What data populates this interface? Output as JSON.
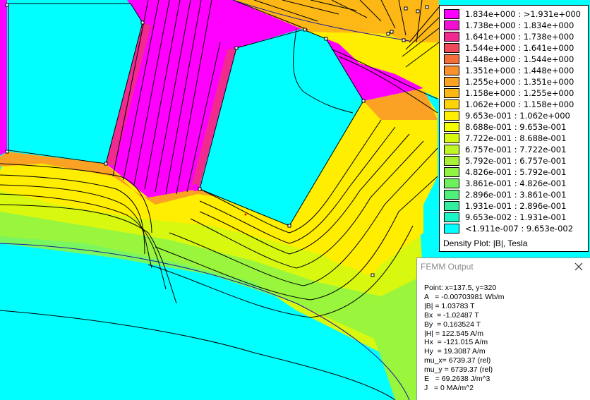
{
  "legend": {
    "entries": [
      {
        "label": "1.834e+000 : >1.931e+000",
        "color": "#ff00ff"
      },
      {
        "label": "1.738e+000 : 1.834e+000",
        "color": "#f10fd2"
      },
      {
        "label": "1.641e+000 : 1.738e+000",
        "color": "#f02a8f"
      },
      {
        "label": "1.544e+000 : 1.641e+000",
        "color": "#ee4a5a"
      },
      {
        "label": "1.448e+000 : 1.544e+000",
        "color": "#f46e3a"
      },
      {
        "label": "1.351e+000 : 1.448e+000",
        "color": "#f8902c"
      },
      {
        "label": "1.255e+000 : 1.351e+000",
        "color": "#fba124"
      },
      {
        "label": "1.158e+000 : 1.255e+000",
        "color": "#fdb815"
      },
      {
        "label": "1.062e+000 : 1.158e+000",
        "color": "#ffd30a"
      },
      {
        "label": "9.653e-001 : 1.062e+000",
        "color": "#ffee00"
      },
      {
        "label": "8.688e-001 : 9.653e-001",
        "color": "#f3ff00"
      },
      {
        "label": "7.722e-001 : 8.688e-001",
        "color": "#d8f810"
      },
      {
        "label": "6.757e-001 : 7.722e-001",
        "color": "#bef524"
      },
      {
        "label": "5.792e-001 : 6.757e-001",
        "color": "#a8f035"
      },
      {
        "label": "4.826e-001 : 5.792e-001",
        "color": "#8ff545"
      },
      {
        "label": "3.861e-001 : 4.826e-001",
        "color": "#6df05e"
      },
      {
        "label": "2.896e-001 : 3.861e-001",
        "color": "#4ff07a"
      },
      {
        "label": "1.931e-001 : 2.896e-001",
        "color": "#34eea0"
      },
      {
        "label": "9.653e-002 : 1.931e-001",
        "color": "#1af5c6"
      },
      {
        "label": "<1.911e-007 : 9.653e-002",
        "color": "#00ffff"
      }
    ],
    "title": "Density Plot: |B|, Tesla"
  },
  "output": {
    "title": "FEMM Output",
    "lines": [
      "Point: x=137.5, y=320",
      "A   = -0.00703981 Wb/m",
      "|B| = 1.03783 T",
      "Bx  = -1.02487 T",
      "By  = 0.163524 T",
      "|H| = 122.545 A/m",
      "Hx  = -121.015 A/m",
      "Hy  = 19.3087 A/m",
      "mu_x= 6739.37 (rel)",
      "mu_y = 6739.37 (rel)",
      "E   = 69.2638 J/m^3",
      "J   = 0 MA/m^2"
    ]
  },
  "colors": {
    "air": "#00ffff",
    "iron_low": "#8ff545",
    "iron_mid": "#ffee00",
    "iron_high": "#fba124",
    "saturated": "#ff00ff"
  }
}
